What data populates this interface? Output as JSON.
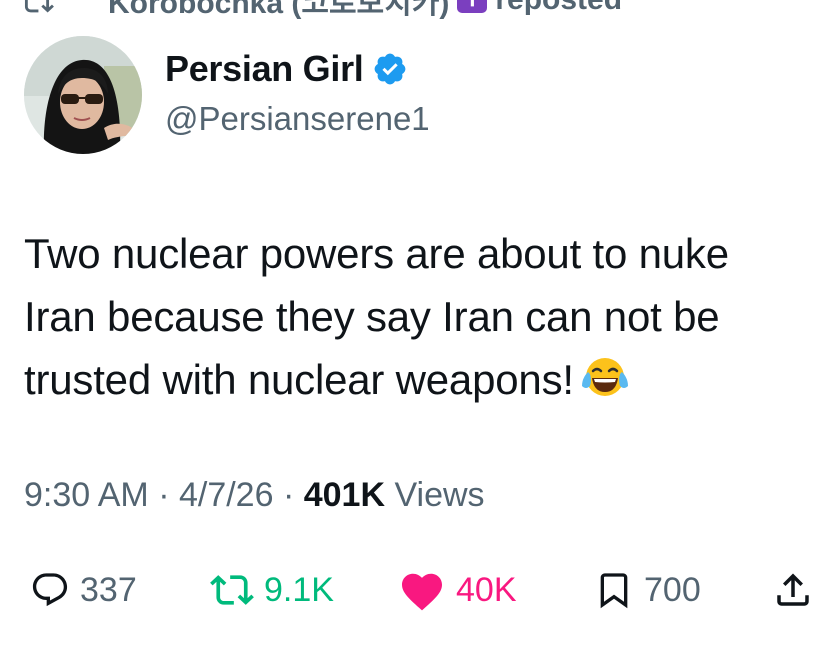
{
  "repost_header": {
    "name": "Korobochka (코로보치카)",
    "suffix": "reposted",
    "icon": "repost-icon"
  },
  "author": {
    "display_name": "Persian Girl",
    "handle": "@Persianserene1",
    "verified_icon": "verified-badge-icon",
    "verified_color": "#1d9bf0"
  },
  "tweet": {
    "line1": "Two nuclear powers are about to nuke",
    "line2": "Iran because they say Iran can not be",
    "line3": "trusted with nuclear weapons!",
    "emoji": "face-with-tears-of-joy"
  },
  "meta": {
    "time": "9:30 AM",
    "sep1": " · ",
    "date": "4/7/26",
    "sep2": " · ",
    "views_count": "401K",
    "views_label": " Views"
  },
  "actions": {
    "replies": "337",
    "reposts": "9.1K",
    "likes": "40K",
    "bookmarks": "700"
  },
  "colors": {
    "text": "#0f1419",
    "secondary": "#536471",
    "repost_green": "#00ba7c",
    "like_pink": "#f91880",
    "verified_blue": "#1d9bf0"
  }
}
